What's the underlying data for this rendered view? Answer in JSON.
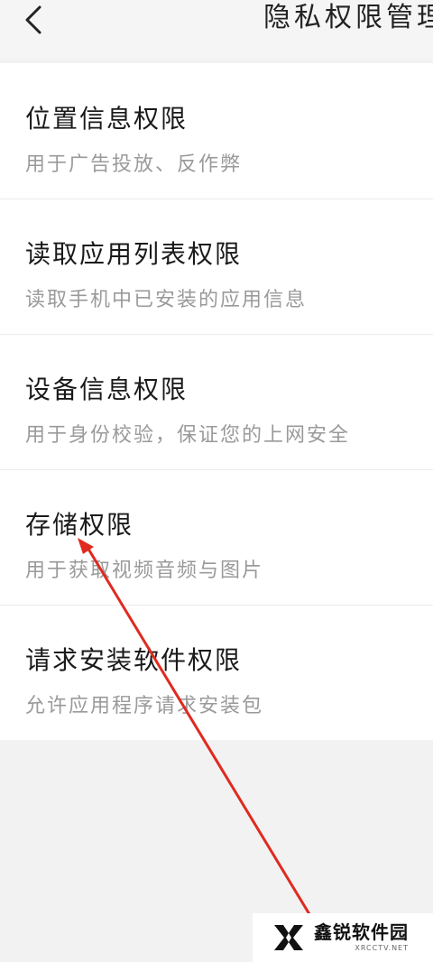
{
  "header": {
    "title": "隐私权限管理",
    "back_icon": "chevron-left-icon"
  },
  "permissions": [
    {
      "title": "位置信息权限",
      "desc": "用于广告投放、反作弊"
    },
    {
      "title": "读取应用列表权限",
      "desc": "读取手机中已安装的应用信息"
    },
    {
      "title": "设备信息权限",
      "desc": "用于身份校验，保证您的上网安全"
    },
    {
      "title": "存储权限",
      "desc": "用于获取视频音频与图片"
    },
    {
      "title": "请求安装软件权限",
      "desc": "允许应用程序请求安装包"
    }
  ],
  "watermark": {
    "name": "鑫锐软件园",
    "url": "XRCCTV.NET"
  },
  "colors": {
    "annotation_arrow": "#e02a1f",
    "background": "#f2f2f2",
    "list_background": "#ffffff",
    "title_text": "#1a1a1a",
    "desc_text": "#9a9a9a"
  }
}
